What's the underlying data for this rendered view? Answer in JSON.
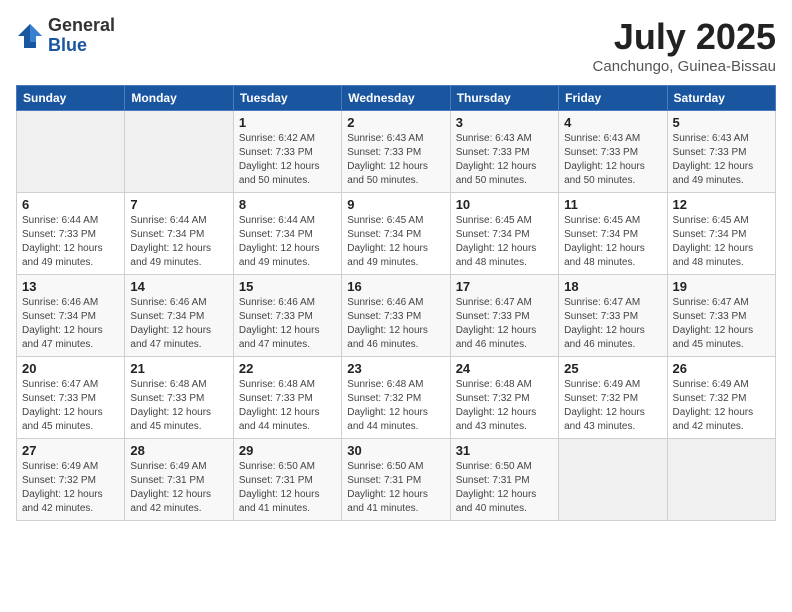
{
  "logo": {
    "general": "General",
    "blue": "Blue"
  },
  "title": {
    "month": "July 2025",
    "location": "Canchungo, Guinea-Bissau"
  },
  "weekdays": [
    "Sunday",
    "Monday",
    "Tuesday",
    "Wednesday",
    "Thursday",
    "Friday",
    "Saturday"
  ],
  "weeks": [
    [
      {
        "day": "",
        "sunrise": "",
        "sunset": "",
        "daylight": ""
      },
      {
        "day": "",
        "sunrise": "",
        "sunset": "",
        "daylight": ""
      },
      {
        "day": "1",
        "sunrise": "Sunrise: 6:42 AM",
        "sunset": "Sunset: 7:33 PM",
        "daylight": "Daylight: 12 hours and 50 minutes."
      },
      {
        "day": "2",
        "sunrise": "Sunrise: 6:43 AM",
        "sunset": "Sunset: 7:33 PM",
        "daylight": "Daylight: 12 hours and 50 minutes."
      },
      {
        "day": "3",
        "sunrise": "Sunrise: 6:43 AM",
        "sunset": "Sunset: 7:33 PM",
        "daylight": "Daylight: 12 hours and 50 minutes."
      },
      {
        "day": "4",
        "sunrise": "Sunrise: 6:43 AM",
        "sunset": "Sunset: 7:33 PM",
        "daylight": "Daylight: 12 hours and 50 minutes."
      },
      {
        "day": "5",
        "sunrise": "Sunrise: 6:43 AM",
        "sunset": "Sunset: 7:33 PM",
        "daylight": "Daylight: 12 hours and 49 minutes."
      }
    ],
    [
      {
        "day": "6",
        "sunrise": "Sunrise: 6:44 AM",
        "sunset": "Sunset: 7:33 PM",
        "daylight": "Daylight: 12 hours and 49 minutes."
      },
      {
        "day": "7",
        "sunrise": "Sunrise: 6:44 AM",
        "sunset": "Sunset: 7:34 PM",
        "daylight": "Daylight: 12 hours and 49 minutes."
      },
      {
        "day": "8",
        "sunrise": "Sunrise: 6:44 AM",
        "sunset": "Sunset: 7:34 PM",
        "daylight": "Daylight: 12 hours and 49 minutes."
      },
      {
        "day": "9",
        "sunrise": "Sunrise: 6:45 AM",
        "sunset": "Sunset: 7:34 PM",
        "daylight": "Daylight: 12 hours and 49 minutes."
      },
      {
        "day": "10",
        "sunrise": "Sunrise: 6:45 AM",
        "sunset": "Sunset: 7:34 PM",
        "daylight": "Daylight: 12 hours and 48 minutes."
      },
      {
        "day": "11",
        "sunrise": "Sunrise: 6:45 AM",
        "sunset": "Sunset: 7:34 PM",
        "daylight": "Daylight: 12 hours and 48 minutes."
      },
      {
        "day": "12",
        "sunrise": "Sunrise: 6:45 AM",
        "sunset": "Sunset: 7:34 PM",
        "daylight": "Daylight: 12 hours and 48 minutes."
      }
    ],
    [
      {
        "day": "13",
        "sunrise": "Sunrise: 6:46 AM",
        "sunset": "Sunset: 7:34 PM",
        "daylight": "Daylight: 12 hours and 47 minutes."
      },
      {
        "day": "14",
        "sunrise": "Sunrise: 6:46 AM",
        "sunset": "Sunset: 7:34 PM",
        "daylight": "Daylight: 12 hours and 47 minutes."
      },
      {
        "day": "15",
        "sunrise": "Sunrise: 6:46 AM",
        "sunset": "Sunset: 7:33 PM",
        "daylight": "Daylight: 12 hours and 47 minutes."
      },
      {
        "day": "16",
        "sunrise": "Sunrise: 6:46 AM",
        "sunset": "Sunset: 7:33 PM",
        "daylight": "Daylight: 12 hours and 46 minutes."
      },
      {
        "day": "17",
        "sunrise": "Sunrise: 6:47 AM",
        "sunset": "Sunset: 7:33 PM",
        "daylight": "Daylight: 12 hours and 46 minutes."
      },
      {
        "day": "18",
        "sunrise": "Sunrise: 6:47 AM",
        "sunset": "Sunset: 7:33 PM",
        "daylight": "Daylight: 12 hours and 46 minutes."
      },
      {
        "day": "19",
        "sunrise": "Sunrise: 6:47 AM",
        "sunset": "Sunset: 7:33 PM",
        "daylight": "Daylight: 12 hours and 45 minutes."
      }
    ],
    [
      {
        "day": "20",
        "sunrise": "Sunrise: 6:47 AM",
        "sunset": "Sunset: 7:33 PM",
        "daylight": "Daylight: 12 hours and 45 minutes."
      },
      {
        "day": "21",
        "sunrise": "Sunrise: 6:48 AM",
        "sunset": "Sunset: 7:33 PM",
        "daylight": "Daylight: 12 hours and 45 minutes."
      },
      {
        "day": "22",
        "sunrise": "Sunrise: 6:48 AM",
        "sunset": "Sunset: 7:33 PM",
        "daylight": "Daylight: 12 hours and 44 minutes."
      },
      {
        "day": "23",
        "sunrise": "Sunrise: 6:48 AM",
        "sunset": "Sunset: 7:32 PM",
        "daylight": "Daylight: 12 hours and 44 minutes."
      },
      {
        "day": "24",
        "sunrise": "Sunrise: 6:48 AM",
        "sunset": "Sunset: 7:32 PM",
        "daylight": "Daylight: 12 hours and 43 minutes."
      },
      {
        "day": "25",
        "sunrise": "Sunrise: 6:49 AM",
        "sunset": "Sunset: 7:32 PM",
        "daylight": "Daylight: 12 hours and 43 minutes."
      },
      {
        "day": "26",
        "sunrise": "Sunrise: 6:49 AM",
        "sunset": "Sunset: 7:32 PM",
        "daylight": "Daylight: 12 hours and 42 minutes."
      }
    ],
    [
      {
        "day": "27",
        "sunrise": "Sunrise: 6:49 AM",
        "sunset": "Sunset: 7:32 PM",
        "daylight": "Daylight: 12 hours and 42 minutes."
      },
      {
        "day": "28",
        "sunrise": "Sunrise: 6:49 AM",
        "sunset": "Sunset: 7:31 PM",
        "daylight": "Daylight: 12 hours and 42 minutes."
      },
      {
        "day": "29",
        "sunrise": "Sunrise: 6:50 AM",
        "sunset": "Sunset: 7:31 PM",
        "daylight": "Daylight: 12 hours and 41 minutes."
      },
      {
        "day": "30",
        "sunrise": "Sunrise: 6:50 AM",
        "sunset": "Sunset: 7:31 PM",
        "daylight": "Daylight: 12 hours and 41 minutes."
      },
      {
        "day": "31",
        "sunrise": "Sunrise: 6:50 AM",
        "sunset": "Sunset: 7:31 PM",
        "daylight": "Daylight: 12 hours and 40 minutes."
      },
      {
        "day": "",
        "sunrise": "",
        "sunset": "",
        "daylight": ""
      },
      {
        "day": "",
        "sunrise": "",
        "sunset": "",
        "daylight": ""
      }
    ]
  ]
}
